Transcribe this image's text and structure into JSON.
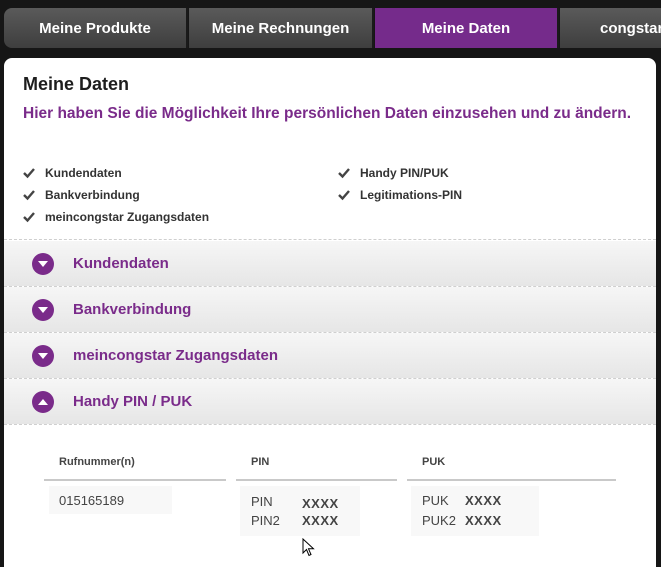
{
  "nav": {
    "tabs": [
      {
        "label": "Meine Produkte",
        "active": false
      },
      {
        "label": "Meine Rechnungen",
        "active": false
      },
      {
        "label": "Meine Daten",
        "active": true
      },
      {
        "label": "congstar",
        "active": false
      }
    ]
  },
  "page": {
    "title": "Meine Daten",
    "subtitle": "Hier haben Sie die Möglichkeit Ihre persönlichen Daten einzusehen und zu ändern."
  },
  "checklist": {
    "left": [
      "Kundendaten",
      "Bankverbindung",
      "meincongstar Zugangsdaten"
    ],
    "right": [
      "Handy PIN/PUK",
      "Legitimations-PIN"
    ]
  },
  "accordion": [
    {
      "label": "Kundendaten",
      "expanded": false
    },
    {
      "label": "Bankverbindung",
      "expanded": false
    },
    {
      "label": "meincongstar Zugangsdaten",
      "expanded": false
    },
    {
      "label": "Handy PIN / PUK",
      "expanded": true
    }
  ],
  "pinpuk": {
    "headers": {
      "number": "Rufnummer(n)",
      "pin": "PIN",
      "puk": "PUK"
    },
    "number": "015165189",
    "pin_rows": [
      {
        "label": "PIN",
        "value": "XXXX"
      },
      {
        "label": "PIN2",
        "value": "XXXX"
      }
    ],
    "puk_rows": [
      {
        "label": "PUK",
        "value": "XXXX"
      },
      {
        "label": "PUK2",
        "value": "XXXX"
      }
    ]
  },
  "colors": {
    "accent": "#7a2b8a",
    "active_tab": "#752b8b",
    "tab": "#4a4a4a"
  }
}
